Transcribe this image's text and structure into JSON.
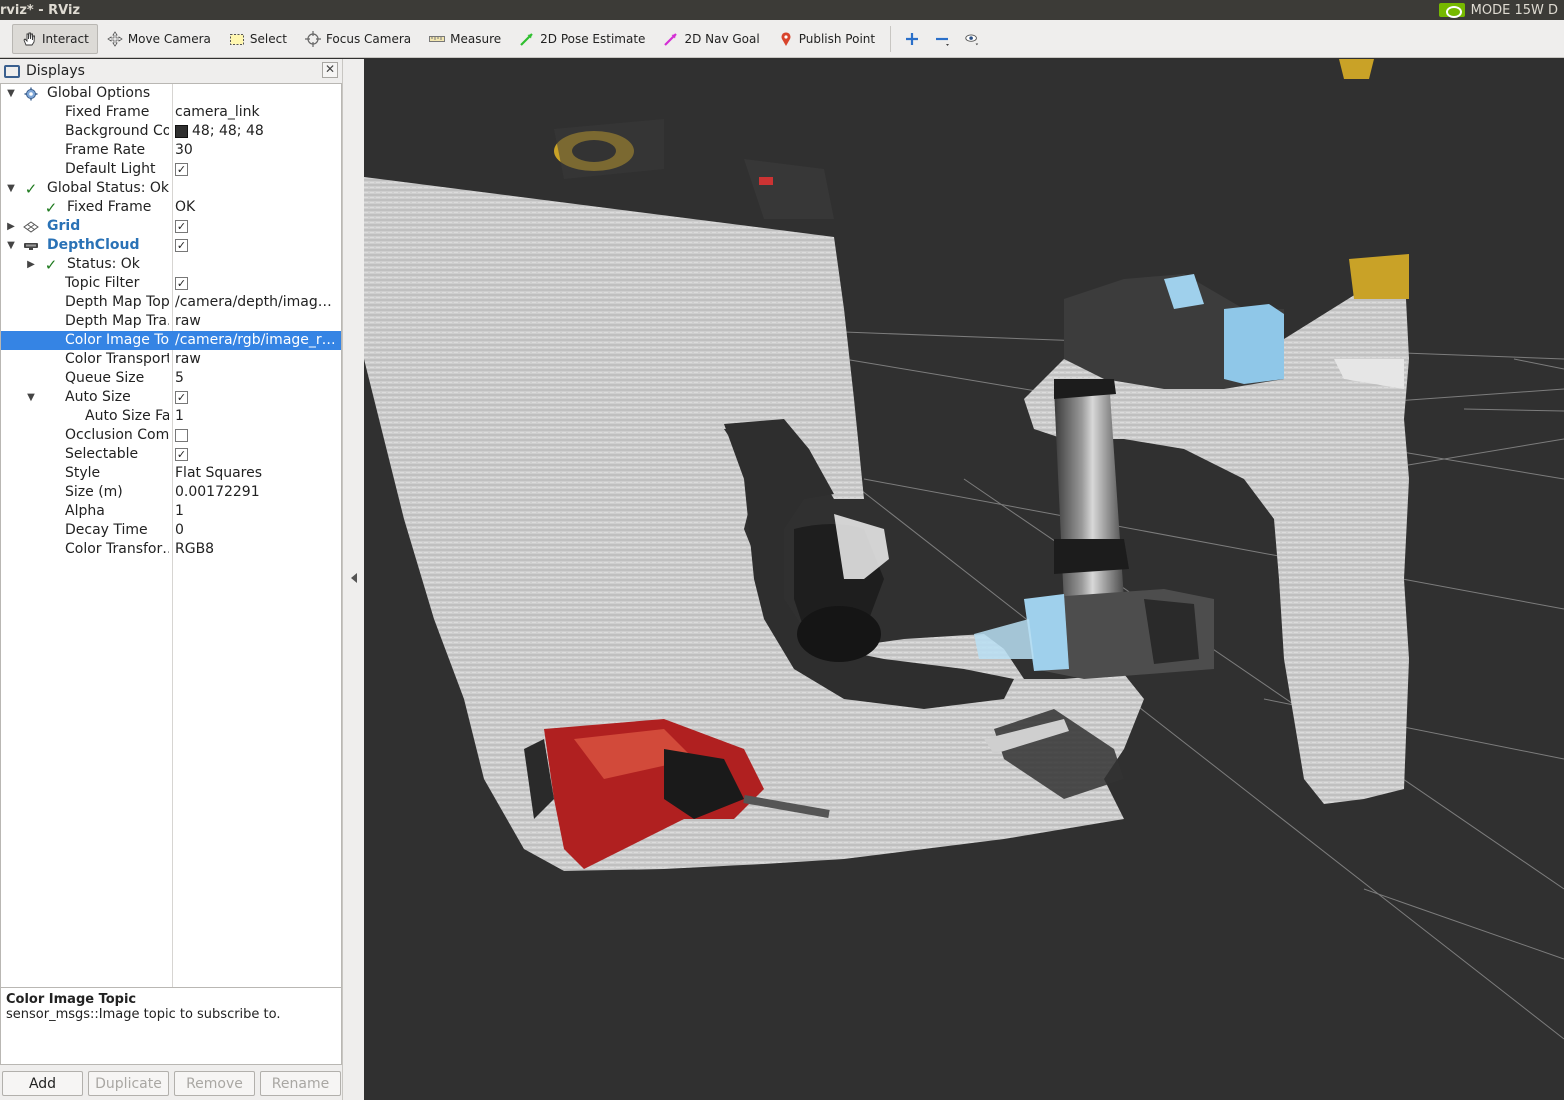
{
  "window": {
    "title": "rviz* - RViz",
    "mode_label": "MODE 15W D"
  },
  "toolbar": {
    "tools": [
      {
        "label": "Interact",
        "icon": "hand-icon",
        "active": true
      },
      {
        "label": "Move Camera",
        "icon": "move-camera-icon",
        "active": false
      },
      {
        "label": "Select",
        "icon": "select-icon",
        "active": false
      },
      {
        "label": "Focus Camera",
        "icon": "focus-camera-icon",
        "active": false
      },
      {
        "label": "Measure",
        "icon": "ruler-icon",
        "active": false
      },
      {
        "label": "2D Pose Estimate",
        "icon": "green-arrow-icon",
        "active": false
      },
      {
        "label": "2D Nav Goal",
        "icon": "magenta-arrow-icon",
        "active": false
      },
      {
        "label": "Publish Point",
        "icon": "map-pin-icon",
        "active": false
      }
    ],
    "extra_icons": [
      "plus-icon",
      "minus-icon",
      "eye-icon"
    ]
  },
  "panel": {
    "title": "Displays",
    "tree": [
      {
        "name": "Global Options",
        "value": "",
        "indent": 0,
        "arrow": "down",
        "icon": "gear-icon",
        "style": "normal"
      },
      {
        "name": "Fixed Frame",
        "value": "camera_link",
        "indent": 1
      },
      {
        "name": "Background Color",
        "value": "48; 48; 48",
        "indent": 1,
        "swatch": "#303030"
      },
      {
        "name": "Frame Rate",
        "value": "30",
        "indent": 1
      },
      {
        "name": "Default Light",
        "value": "",
        "indent": 1,
        "checkbox": true
      },
      {
        "name": "Global Status: Ok",
        "value": "",
        "indent": 0,
        "arrow": "down",
        "icon": "check-icon"
      },
      {
        "name": "Fixed Frame",
        "value": "OK",
        "indent": 1,
        "icon": "check-icon"
      },
      {
        "name": "Grid",
        "value": "",
        "indent": 0,
        "arrow": "right",
        "icon": "grid-icon",
        "style": "bold",
        "checkbox": true
      },
      {
        "name": "DepthCloud",
        "value": "",
        "indent": 0,
        "arrow": "down",
        "icon": "depthcloud-icon",
        "style": "bold",
        "checkbox": true
      },
      {
        "name": "Status: Ok",
        "value": "",
        "indent": 1,
        "arrow": "right",
        "icon": "check-icon"
      },
      {
        "name": "Topic Filter",
        "value": "",
        "indent": 1,
        "checkbox": true
      },
      {
        "name": "Depth Map Topic",
        "value": "/camera/depth/imag…",
        "indent": 1
      },
      {
        "name": "Depth Map Tra…",
        "value": "raw",
        "indent": 1
      },
      {
        "name": "Color Image Topic",
        "value": "/camera/rgb/image_r…",
        "indent": 1,
        "selected": true
      },
      {
        "name": "Color Transport…",
        "value": "raw",
        "indent": 1
      },
      {
        "name": "Queue Size",
        "value": "5",
        "indent": 1
      },
      {
        "name": "Auto Size",
        "value": "",
        "indent": 1,
        "arrow": "down",
        "checkbox": true
      },
      {
        "name": "Auto Size Fac…",
        "value": "1",
        "indent": 2
      },
      {
        "name": "Occlusion Com…",
        "value": "",
        "indent": 1,
        "checkbox": false
      },
      {
        "name": "Selectable",
        "value": "",
        "indent": 1,
        "checkbox": true
      },
      {
        "name": "Style",
        "value": "Flat Squares",
        "indent": 1
      },
      {
        "name": "Size (m)",
        "value": "0.00172291",
        "indent": 1
      },
      {
        "name": "Alpha",
        "value": "1",
        "indent": 1
      },
      {
        "name": "Decay Time",
        "value": "0",
        "indent": 1
      },
      {
        "name": "Color Transfor…",
        "value": "RGB8",
        "indent": 1
      }
    ],
    "help": {
      "title": "Color Image Topic",
      "text": "sensor_msgs::Image topic to subscribe to."
    },
    "buttons": [
      {
        "label": "Add",
        "enabled": true
      },
      {
        "label": "Duplicate",
        "enabled": false
      },
      {
        "label": "Remove",
        "enabled": false
      },
      {
        "label": "Rename",
        "enabled": false
      }
    ]
  },
  "viewport": {
    "background": "#303030"
  }
}
